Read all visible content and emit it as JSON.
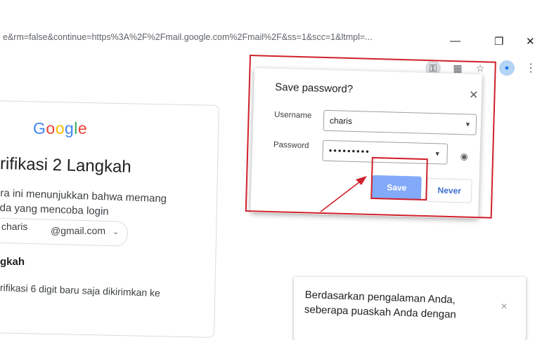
{
  "browser": {
    "url": "e&rm=false&continue=https%3A%2F%2Fmail.google.com%2Fmail%2F&ss=1&scc=1&ltmpl=...",
    "icons": {
      "minimize": "minimize-icon",
      "restore": "restore-icon",
      "close": "close-icon",
      "key": "key-icon",
      "translate": "translate-icon",
      "star": "star-icon",
      "avatar": "avatar-icon",
      "more": "more-icon"
    }
  },
  "card": {
    "logo": [
      "G",
      "o",
      "o",
      "g",
      "l",
      "e"
    ],
    "heading": "rifikasi 2 Langkah",
    "desc_line1": "ra ini menunjukkan bahwa memang",
    "desc_line2": "da yang mencoba login",
    "account_name": "charis",
    "account_email": "@gmail.com",
    "sub_heading": "gkah",
    "sub_desc": "rifikasi 6 digit baru saja dikirimkan ke"
  },
  "dialog": {
    "title": "Save password?",
    "username_label": "Username",
    "username_value": "charis",
    "password_label": "Password",
    "password_value": "•••••••••",
    "save_label": "Save",
    "never_label": "Never"
  },
  "survey": {
    "text_line1": "Berdasarkan pengalaman Anda,",
    "text_line2": "seberapa puaskah Anda dengan"
  },
  "colors": {
    "annotation_red": "#d0212b",
    "save_button": "#82aaf9",
    "never_text": "#3b6fd0"
  }
}
